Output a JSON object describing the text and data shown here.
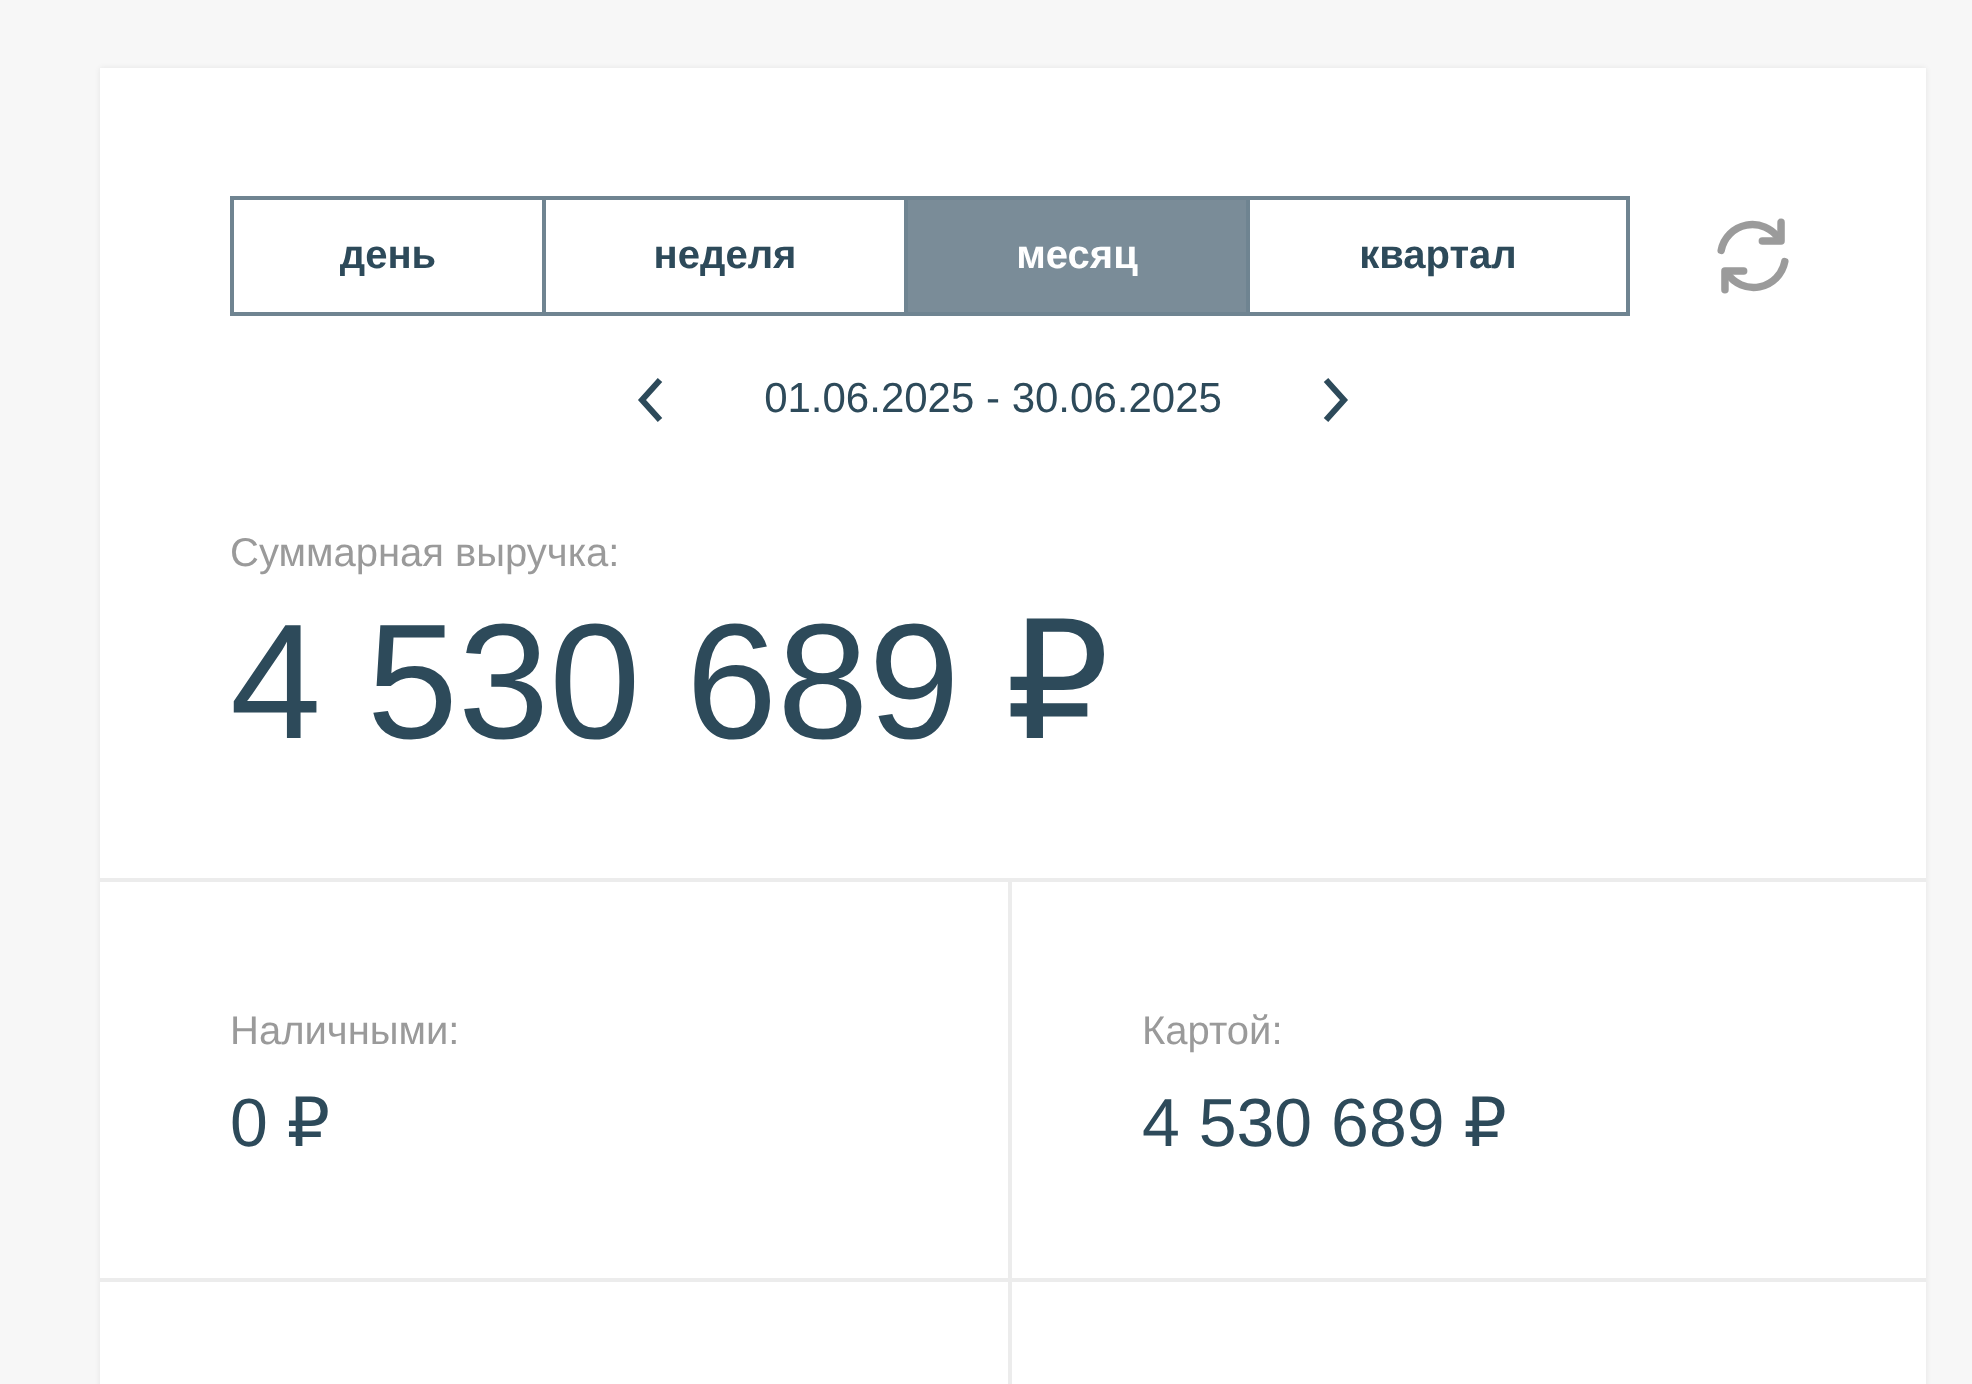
{
  "periods": [
    {
      "label": "день",
      "selected": false
    },
    {
      "label": "неделя",
      "selected": false
    },
    {
      "label": "месяц",
      "selected": true
    },
    {
      "label": "квартал",
      "selected": false
    }
  ],
  "date_range": "01.06.2025 - 30.06.2025",
  "total": {
    "label": "Суммарная выручка:",
    "value": "4 530 689 ₽"
  },
  "breakdown": [
    {
      "label": "Наличными:",
      "value": "0 ₽"
    },
    {
      "label": "Картой:",
      "value": "4 530 689 ₽"
    }
  ]
}
